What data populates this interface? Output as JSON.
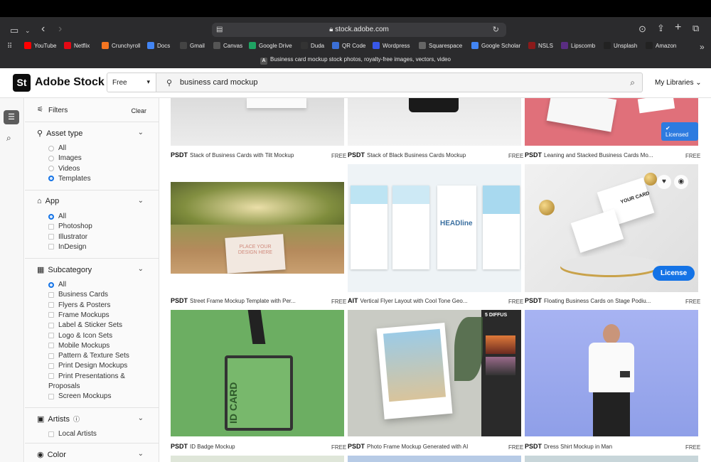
{
  "browser": {
    "url": "stock.adobe.com",
    "tab_title": "Business card mockup stock photos, royalty-free images, vectors, video",
    "bookmarks": [
      {
        "label": "YouTube",
        "color": "#ff0000"
      },
      {
        "label": "Netflix",
        "color": "#e50914"
      },
      {
        "label": "Crunchyroll",
        "color": "#f47521"
      },
      {
        "label": "Docs",
        "color": "#4285f4"
      },
      {
        "label": "Gmail",
        "color": "#444444"
      },
      {
        "label": "Canvas",
        "color": "#555555"
      },
      {
        "label": "Google Drive",
        "color": "#1fa463"
      },
      {
        "label": "Duda",
        "color": "#333333"
      },
      {
        "label": "QR Code",
        "color": "#3b6fd6"
      },
      {
        "label": "Wordpress",
        "color": "#3858e9"
      },
      {
        "label": "Squarespace",
        "color": "#666666"
      },
      {
        "label": "Google Scholar",
        "color": "#4285f4"
      },
      {
        "label": "NSLS",
        "color": "#8b1a1a"
      },
      {
        "label": "Lipscomb",
        "color": "#5a2d82"
      },
      {
        "label": "Unsplash",
        "color": "#222222"
      },
      {
        "label": "Amazon",
        "color": "#222222"
      }
    ]
  },
  "header": {
    "logo": "St",
    "brand": "Adobe Stock",
    "filter_select": "Free",
    "search_value": "business card mockup",
    "my_libraries": "My Libraries"
  },
  "filters": {
    "title": "Filters",
    "clear": "Clear",
    "asset_type": {
      "label": "Asset type",
      "options": [
        "All",
        "Images",
        "Videos",
        "Templates"
      ],
      "selected": "Templates"
    },
    "app": {
      "label": "App",
      "options": [
        "All",
        "Photoshop",
        "Illustrator",
        "InDesign"
      ],
      "selected": "All"
    },
    "subcategory": {
      "label": "Subcategory",
      "options": [
        "All",
        "Business Cards",
        "Flyers & Posters",
        "Frame Mockups",
        "Label & Sticker Sets",
        "Logo & Icon Sets",
        "Mobile Mockups",
        "Pattern & Texture Sets",
        "Print Design Mockups",
        "Print Presentations &",
        "Proposals",
        "Screen Mockups"
      ],
      "selected": "All"
    },
    "artists": {
      "label": "Artists",
      "options": [
        "Local Artists"
      ]
    },
    "color": {
      "label": "Color"
    }
  },
  "results": [
    {
      "type": "PSDT",
      "title": "Stack of Business Cards with Tilt Mockup",
      "price": "FREE"
    },
    {
      "type": "PSDT",
      "title": "Stack of Black Business Cards Mockup",
      "price": "FREE"
    },
    {
      "type": "PSDT",
      "title": "Leaning and Stacked Business Cards Mo...",
      "price": "FREE",
      "badge": "Licensed"
    },
    {
      "type": "PSDT",
      "title": "Street Frame Mockup Template with Per...",
      "price": "FREE",
      "overlay": "PLACE YOUR DESIGN HERE"
    },
    {
      "type": "AIT",
      "title": "Vertical Flyer Layout with Cool Tone Geo...",
      "price": "FREE",
      "overlay": "HEADline"
    },
    {
      "type": "PSDT",
      "title": "Floating Business Cards on Stage Podiu...",
      "price": "FREE",
      "button": "License",
      "overlay": "YOUR CARD"
    },
    {
      "type": "PSDT",
      "title": "ID Badge Mockup",
      "price": "FREE",
      "overlay": "ID CARD"
    },
    {
      "type": "PSDT",
      "title": "Photo Frame Mockup Generated with AI",
      "price": "FREE",
      "overlay": "5 DIFFUS"
    },
    {
      "type": "PSDT",
      "title": "Dress Shirt Mockup in Man",
      "price": "FREE"
    }
  ]
}
